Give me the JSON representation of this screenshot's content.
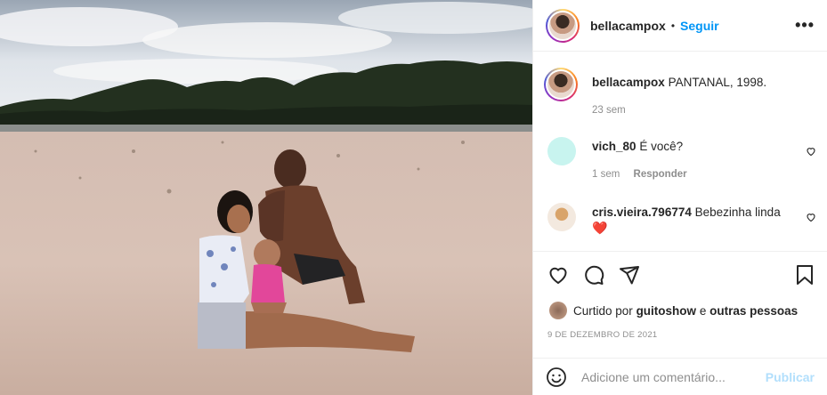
{
  "post": {
    "author": "bellacampox",
    "follow_label": "Seguir",
    "separator": "•",
    "more_label": "•••"
  },
  "caption": {
    "user": "bellacampox",
    "text": "PANTANAL, 1998.",
    "time": "23 sem"
  },
  "comments": [
    {
      "user": "vich_80",
      "text": "É você?",
      "time": "1 sem",
      "reply_label": "Responder",
      "avatar_color": "#c8f4ef"
    },
    {
      "user": "cris.vieira.796774",
      "text": "Bebezinha linda",
      "emoji": "❤️"
    }
  ],
  "likes": {
    "prefix": "Curtido por",
    "user": "guitoshow",
    "conj": "e",
    "others": "outras pessoas"
  },
  "date": "9 DE DEZEMBRO DE 2021",
  "composer": {
    "placeholder": "Adicione um comentário...",
    "submit_label": "Publicar"
  },
  "colors": {
    "link_blue": "#0095f6",
    "publish_disabled": "#b2dffc",
    "heart_red": "#ed4956"
  }
}
